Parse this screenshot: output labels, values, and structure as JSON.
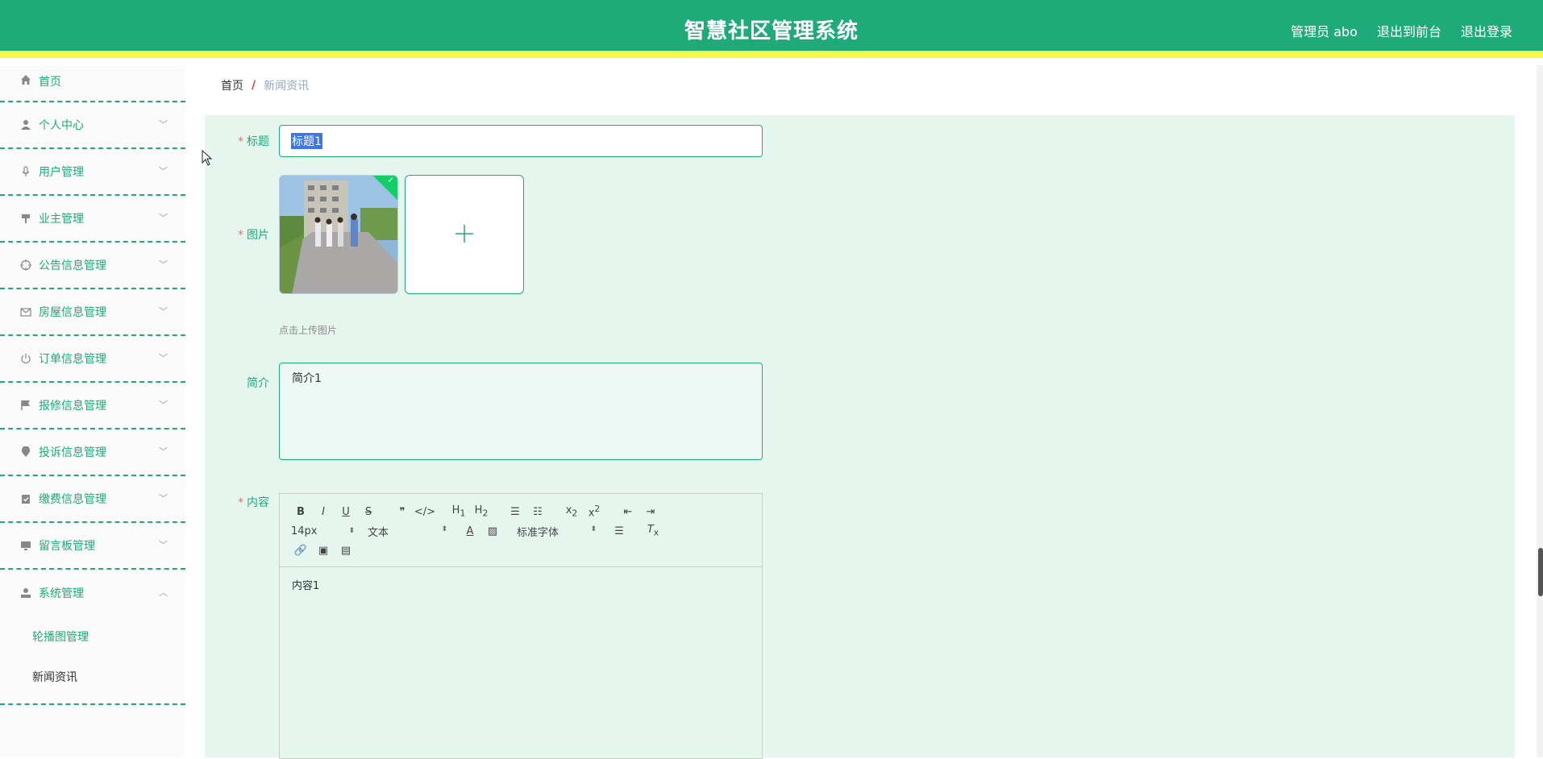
{
  "header": {
    "title": "智慧社区管理系统",
    "admin_label": "管理员 abo",
    "to_front": "退出到前台",
    "logout": "退出登录"
  },
  "sidebar": {
    "home": "首页",
    "items": [
      {
        "label": "个人中心",
        "icon": "user-icon"
      },
      {
        "label": "用户管理",
        "icon": "microphone-icon"
      },
      {
        "label": "业主管理",
        "icon": "brush-icon"
      },
      {
        "label": "公告信息管理",
        "icon": "aim-icon"
      },
      {
        "label": "房屋信息管理",
        "icon": "message-icon"
      },
      {
        "label": "订单信息管理",
        "icon": "power-icon"
      },
      {
        "label": "报修信息管理",
        "icon": "flag-icon"
      },
      {
        "label": "投诉信息管理",
        "icon": "location-icon"
      },
      {
        "label": "缴费信息管理",
        "icon": "finished-icon"
      },
      {
        "label": "留言板管理",
        "icon": "monitor-icon"
      },
      {
        "label": "系统管理",
        "icon": "user-solid-icon"
      }
    ],
    "sub_items": [
      "轮播图管理",
      "新闻资讯"
    ]
  },
  "breadcrumb": {
    "home": "首页",
    "separator": "/",
    "current": "新闻资讯"
  },
  "form": {
    "title_label": "标题",
    "title_value": "标题1",
    "image_label": "图片",
    "upload_tip": "点击上传图片",
    "intro_label": "简介",
    "intro_value": "简介1",
    "content_label": "内容",
    "content_value": "内容1",
    "required_mark": "*"
  },
  "editor_toolbar": {
    "font_size": "14px",
    "header_picker": "文本",
    "font_picker": "标准字体"
  }
}
